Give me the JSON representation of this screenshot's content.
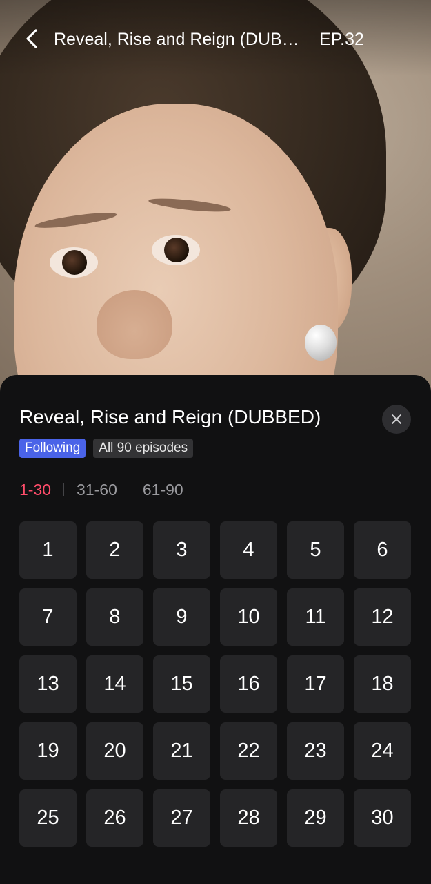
{
  "header": {
    "title": "Reveal, Rise and Reign (DUBB…",
    "episode": "EP.32",
    "back_icon": "chevron-left-icon"
  },
  "sheet": {
    "title": "Reveal, Rise and Reign (DUBBED)",
    "close_icon": "close-icon",
    "badges": {
      "following": "Following",
      "episode_count": "All 90 episodes"
    },
    "ranges": [
      {
        "label": "1-30",
        "active": true
      },
      {
        "label": "31-60",
        "active": false
      },
      {
        "label": "61-90",
        "active": false
      }
    ],
    "episodes": [
      "1",
      "2",
      "3",
      "4",
      "5",
      "6",
      "7",
      "8",
      "9",
      "10",
      "11",
      "12",
      "13",
      "14",
      "15",
      "16",
      "17",
      "18",
      "19",
      "20",
      "21",
      "22",
      "23",
      "24",
      "25",
      "26",
      "27",
      "28",
      "29",
      "30"
    ]
  },
  "colors": {
    "accent_range": "#ff4d6a",
    "following_badge": "#4a63e8",
    "sheet_bg": "#111112",
    "tile_bg": "#252527"
  }
}
